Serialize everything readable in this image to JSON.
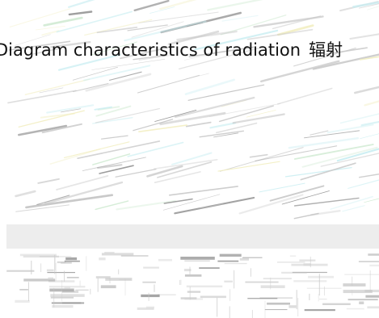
{
  "title": {
    "text_en": "Diagram characteristics of radiation",
    "text_cn": "辐射"
  },
  "colors": {
    "background": "#ffffff",
    "text": "#111111",
    "stroke_gray": "#c8c8c8",
    "stroke_dark": "#8a8a8a",
    "tint_green": "#cde9cf",
    "tint_cyan": "#c9eef2",
    "tint_yellow": "#f2eebf",
    "band": "#ededed"
  }
}
